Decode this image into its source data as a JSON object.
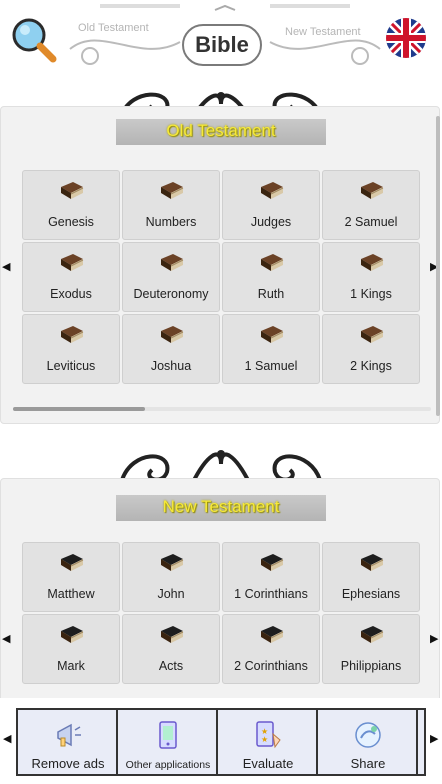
{
  "header": {
    "tab_old": "Old Testament",
    "tab_new": "New Testament",
    "title": "Bible",
    "search_icon": "magnifier-icon",
    "language_icon": "uk-flag-icon"
  },
  "old_testament": {
    "title": "Old Testament",
    "books": [
      "Genesis",
      "Numbers",
      "Judges",
      "2 Samuel",
      "Exodus",
      "Deuteronomy",
      "Ruth",
      "1 Kings",
      "Leviticus",
      "Joshua",
      "1 Samuel",
      "2 Kings"
    ]
  },
  "new_testament": {
    "title": "New Testament",
    "books": [
      "Matthew",
      "John",
      "1 Corinthians",
      "Ephesians",
      "Mark",
      "Acts",
      "2 Corinthians",
      "Philippians"
    ]
  },
  "bottom_bar": {
    "actions": [
      "Remove ads",
      "Other applications",
      "Evaluate",
      "Share"
    ]
  },
  "colors": {
    "banner_text": "#f6e93a",
    "ot_book": "#6b4226",
    "nt_book": "#1e1e1e",
    "bottom_bg": "#e9ecf7"
  }
}
